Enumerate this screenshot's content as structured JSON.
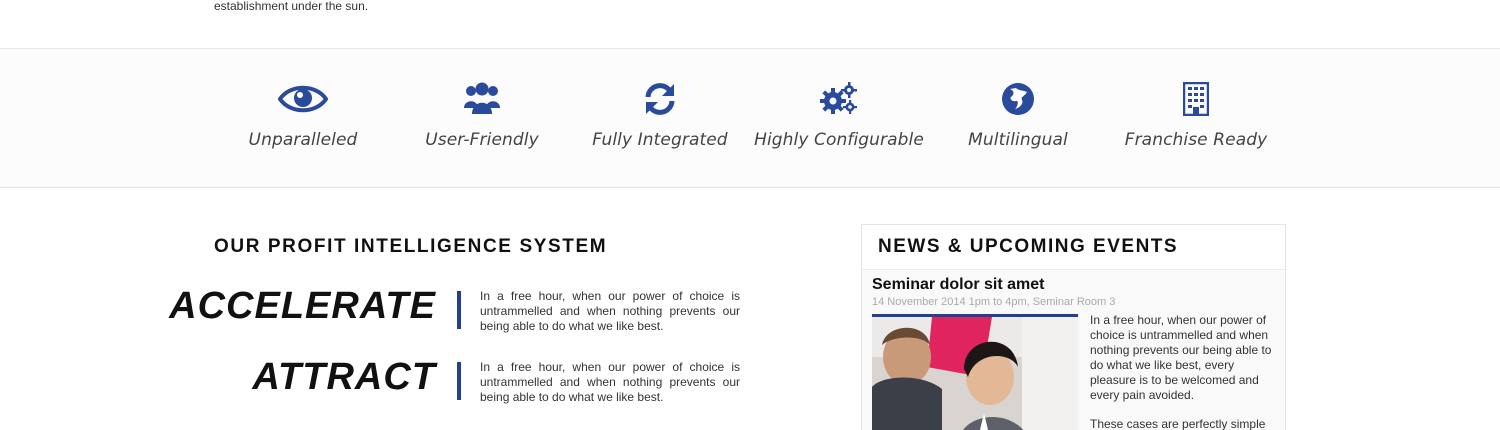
{
  "intro": {
    "tail_text": "establishment under the sun."
  },
  "features": [
    {
      "label": "Unparalleled",
      "icon": "eye-icon"
    },
    {
      "label": "User-Friendly",
      "icon": "users-icon"
    },
    {
      "label": "Fully Integrated",
      "icon": "refresh-icon"
    },
    {
      "label": "Highly Configurable",
      "icon": "gears-icon"
    },
    {
      "label": "Multilingual",
      "icon": "globe-icon"
    },
    {
      "label": "Franchise Ready",
      "icon": "building-icon"
    }
  ],
  "profit_system": {
    "title": "OUR PROFIT INTELLIGENCE SYSTEM",
    "items": [
      {
        "word": "ACCELERATE",
        "text": "In a free hour, when our power of choice is untrammelled and when nothing prevents our being able to do what we like best."
      },
      {
        "word": "ATTRACT",
        "text": "In a free hour, when our power of choice is untrammelled and when nothing prevents our being able to do what we like best."
      }
    ]
  },
  "news": {
    "title": "NEWS & UPCOMING EVENTS",
    "event": {
      "title": "Seminar dolor sit amet",
      "meta": "14 November 2014 1pm to 4pm, Seminar Room 3",
      "text": "In a free hour, when our power of choice is untrammelled and when nothing prevents our being able to do what we like best, every pleasure is to be welcomed and every pain avoided.",
      "text2": "These cases are perfectly simple"
    }
  },
  "colors": {
    "accent": "#243f8f",
    "icon_blue": "#2a4a9b"
  }
}
